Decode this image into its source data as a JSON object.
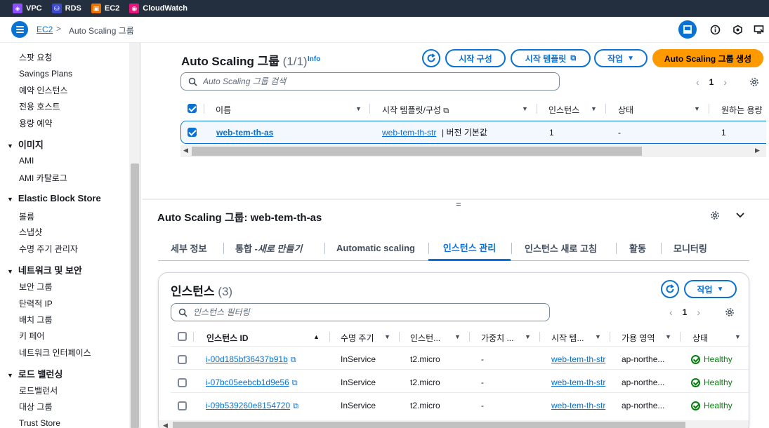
{
  "bookmarks": [
    {
      "label": "VPC",
      "color": "#8c4fff",
      "icon": "vpc-icon"
    },
    {
      "label": "RDS",
      "color": "#3b48cc",
      "icon": "rds-icon"
    },
    {
      "label": "EC2",
      "color": "#ed7100",
      "icon": "ec2-icon"
    },
    {
      "label": "CloudWatch",
      "color": "#e7157b",
      "icon": "cloudwatch-icon"
    }
  ],
  "breadcrumb": {
    "root": "EC2",
    "separator": ">",
    "current": "Auto Scaling 그룹"
  },
  "sidebar": {
    "items_top": [
      "스팟 요청",
      "Savings Plans",
      "예약 인스턴스",
      "전용 호스트",
      "용량 예약"
    ],
    "sections": [
      {
        "title": "이미지",
        "items": [
          "AMI",
          "AMI 카탈로그"
        ]
      },
      {
        "title": "Elastic Block Store",
        "items": [
          "볼륨",
          "스냅샷",
          "수명 주기 관리자"
        ]
      },
      {
        "title": "네트워크 및 보안",
        "items": [
          "보안 그룹",
          "탄력적 IP",
          "배치 그룹",
          "키 페어",
          "네트워크 인터페이스"
        ]
      },
      {
        "title": "로드 밸런싱",
        "items": [
          "로드밸런서",
          "대상 그룹",
          "Trust Store"
        ]
      }
    ]
  },
  "asg_panel": {
    "title": "Auto Scaling 그룹",
    "count": "(1/1)",
    "info": "Info",
    "buttons": {
      "launch_config": "시작 구성",
      "launch_template": "시작 템플릿",
      "actions": "작업",
      "create": "Auto Scaling 그룹 생성"
    },
    "search_placeholder": "Auto Scaling 그룹 검색",
    "page": "1",
    "columns": [
      "이름",
      "시작 템플릿/구성",
      "인스턴스",
      "상태",
      "원하는 용량"
    ],
    "row": {
      "name": "web-tem-th-as",
      "template": "web-tem-th-str",
      "template_suffix": "| 버전 기본값",
      "instances": "1",
      "status": "-",
      "desired": "1"
    }
  },
  "split_handle": "=",
  "detail": {
    "title": "Auto Scaling 그룹: web-tem-th-as",
    "tabs": {
      "details": "세부 정보",
      "integration_prefix": "통합 - ",
      "integration_new": "새로 만들기",
      "auto_scaling": "Automatic scaling",
      "instance_mgmt": "인스턴스 관리",
      "refresh": "인스턴스 새로 고침",
      "activity": "활동",
      "monitoring": "모니터링"
    }
  },
  "instances": {
    "title": "인스턴스",
    "count": "(3)",
    "actions": "작업",
    "filter_placeholder": "인스턴스 필터링",
    "page": "1",
    "columns": [
      "인스턴스 ID",
      "수명 주기",
      "인스턴... ",
      "가중치 ...",
      "시작 템...",
      "가용 영역",
      "상태"
    ],
    "rows": [
      {
        "id": "i-00d185bf36437b91b",
        "lifecycle": "InService",
        "type": "t2.micro",
        "weight": "-",
        "template": "web-tem-th-str",
        "az": "ap-northe...",
        "health": "Healthy"
      },
      {
        "id": "i-07bc05eebcb1d9e56",
        "lifecycle": "InService",
        "type": "t2.micro",
        "weight": "-",
        "template": "web-tem-th-str",
        "az": "ap-northe...",
        "health": "Healthy"
      },
      {
        "id": "i-09b539260e8154720",
        "lifecycle": "InService",
        "type": "t2.micro",
        "weight": "-",
        "template": "web-tem-th-str",
        "az": "ap-northe...",
        "health": "Healthy"
      }
    ]
  },
  "colors": {
    "accent": "#0972d3",
    "primary_button": "#ff9900",
    "healthy": "#037f0c",
    "header_bg": "#232f3e"
  }
}
